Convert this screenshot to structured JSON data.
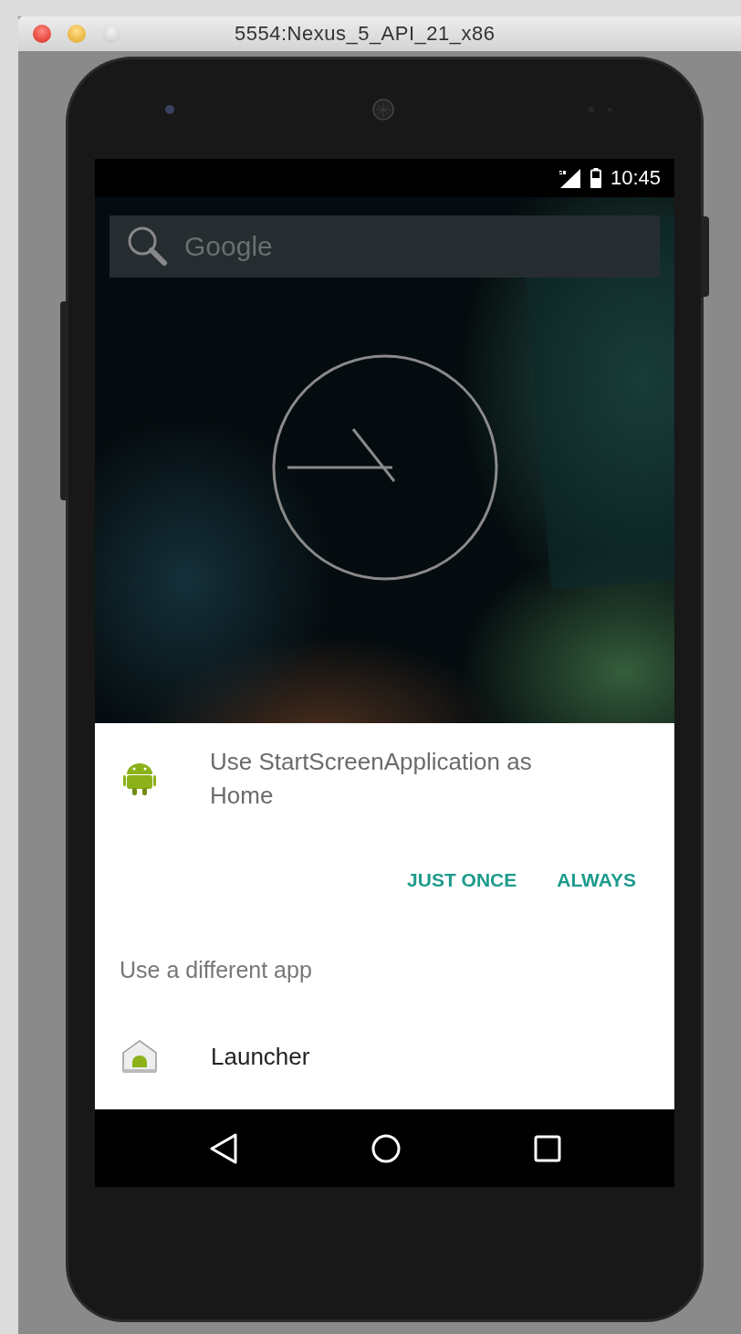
{
  "window": {
    "title": "5554:Nexus_5_API_21_x86"
  },
  "status_bar": {
    "time": "10:45"
  },
  "search": {
    "placeholder": "Google"
  },
  "dialog": {
    "title": "Use StartScreenApplication as Home",
    "buttons": [
      "JUST ONCE",
      "ALWAYS"
    ],
    "section_label": "Use a different app",
    "apps": [
      {
        "name": "Launcher"
      }
    ]
  }
}
